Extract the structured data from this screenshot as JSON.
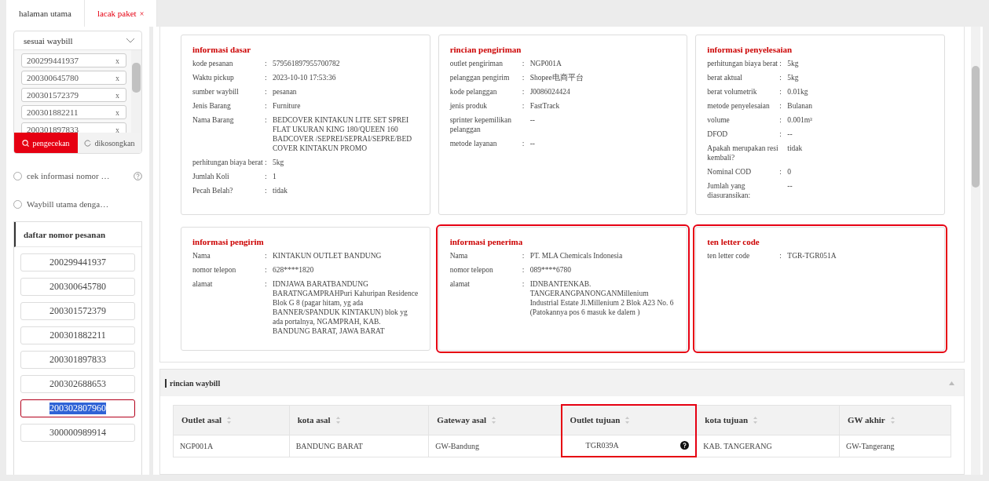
{
  "tabs": [
    {
      "label": "halaman utama",
      "selected": false
    },
    {
      "label": "lacak paket",
      "selected": true,
      "close": "×"
    }
  ],
  "search": {
    "mode": "sesuai waybill",
    "tags": [
      {
        "number": "200299441937",
        "remove": "x"
      },
      {
        "number": "200300645780",
        "remove": "x"
      },
      {
        "number": "200301572379",
        "remove": "x"
      },
      {
        "number": "200301882211",
        "remove": "x"
      },
      {
        "number": "200301897833",
        "remove": "x"
      }
    ],
    "buttons": [
      {
        "kind": "primary",
        "label": "pengecekan"
      },
      {
        "kind": "secondary",
        "label": "dikosongkan"
      }
    ],
    "options": [
      {
        "label": "cek informasi nomor …",
        "selected": false,
        "help": true
      },
      {
        "label": "Waybill utama denga…",
        "selected": false,
        "help": false
      }
    ]
  },
  "order_list": {
    "title": "daftar nomor pesanan",
    "items": [
      {
        "number": "200299441937",
        "selected": false
      },
      {
        "number": "200300645780",
        "selected": false
      },
      {
        "number": "200301572379",
        "selected": false
      },
      {
        "number": "200301882211",
        "selected": false
      },
      {
        "number": "200301897833",
        "selected": false
      },
      {
        "number": "200302688653",
        "selected": false
      },
      {
        "number": "200302807960",
        "selected": true
      },
      {
        "number": "300000989914",
        "selected": false
      }
    ]
  },
  "cards": [
    {
      "title": "informasi dasar",
      "highlighted": false,
      "fields": [
        {
          "label": "kode pesanan",
          "sep": ":",
          "value": "579561897955700782"
        },
        {
          "label": "Waktu pickup",
          "sep": ":",
          "value": "2023-10-10 17:53:36"
        },
        {
          "label": "sumber waybill",
          "sep": ":",
          "value": "pesanan"
        },
        {
          "label": "Jenis Barang",
          "sep": ":",
          "value": "Furniture"
        },
        {
          "label": "Nama Barang",
          "sep": ":",
          "value": "BEDCOVER KINTAKUN LITE SET SPREI FLAT UKURAN KING 180/QUEEN 160 BADCOVER /SEPREI/SEPRAI/SEPRE/BED COVER KINTAKUN PROMO"
        },
        {
          "label": "perhitungan biaya berat",
          "sep": ":",
          "value": "5kg"
        },
        {
          "label": "Jumlah Koli",
          "sep": ":",
          "value": "1"
        },
        {
          "label": "Pecah Belah?",
          "sep": ":",
          "value": "tidak"
        }
      ]
    },
    {
      "title": "rincian pengiriman",
      "highlighted": false,
      "fields": [
        {
          "label": "outlet pengiriman",
          "sep": ":",
          "value": "NGP001A"
        },
        {
          "label": "pelanggan pengirim",
          "sep": ":",
          "value": "Shopee电商平台"
        },
        {
          "label": "kode pelanggan",
          "sep": ":",
          "value": "J0086024424"
        },
        {
          "label": "jenis produk",
          "sep": ":",
          "value": "FastTrack"
        },
        {
          "label": "sprinter kepemilikan pelanggan",
          "value": "--"
        },
        {
          "label": "metode layanan",
          "sep": ":",
          "value": "--"
        }
      ]
    },
    {
      "title": "informasi penyelesaian",
      "highlighted": false,
      "fields": [
        {
          "label": "perhitungan biaya berat",
          "sep": ":",
          "value": "5kg"
        },
        {
          "label": "berat aktual",
          "sep": ":",
          "value": "5kg"
        },
        {
          "label": "berat volumetrik",
          "sep": ":",
          "value": "0.01kg"
        },
        {
          "label": "metode penyelesaian",
          "sep": ":",
          "value": "Bulanan"
        },
        {
          "label": "volume",
          "sep": ":",
          "value": "0.001m³"
        },
        {
          "label": "DFOD",
          "sep": ":",
          "value": "--"
        },
        {
          "label": "Apakah merupakan resi kembali?",
          "value": "tidak"
        },
        {
          "label": "Nominal COD",
          "sep": ":",
          "value": "0"
        },
        {
          "label": "Jumlah yang diasuransikan:",
          "value": "--"
        }
      ]
    },
    {
      "title": "informasi pengirim",
      "highlighted": false,
      "fields": [
        {
          "label": "Nama",
          "sep": ":",
          "value": "KINTAKUN OUTLET BANDUNG"
        },
        {
          "label": "nomor telepon",
          "sep": ":",
          "value": "628****1820"
        },
        {
          "label": "alamat",
          "sep": ":",
          "value": "IDNJAWA BARATBANDUNG BARATNGAMPRAHPuri Kahuripan Residence Blok G 8 (pagar hitam, yg ada BANNER/SPANDUK KINTAKUN) blok yg ada portalnya, NGAMPRAH, KAB. BANDUNG BARAT, JAWA BARAT"
        }
      ]
    },
    {
      "title": "informasi penerima",
      "highlighted": true,
      "fields": [
        {
          "label": "Nama",
          "sep": ":",
          "value": "PT. MLA Chemicals Indonesia"
        },
        {
          "label": "nomor telepon",
          "sep": ":",
          "value": "089****6780"
        },
        {
          "label": "alamat",
          "sep": ":",
          "value": "IDNBANTENKAB. TANGERANGPANONGANMillenium Industrial Estate Jl.Millenium 2 Blok A23 No. 6 (Patokannya pos 6 masuk ke dalem )"
        }
      ]
    },
    {
      "title": "ten letter code",
      "highlighted": true,
      "fields": [
        {
          "label": "ten letter code",
          "sep": ":",
          "value": "TGR-TGR051A"
        }
      ]
    }
  ],
  "waybill_section": {
    "title": "rincian waybill",
    "expanded": true,
    "columns": [
      {
        "label": "Outlet asal",
        "highlighted": false
      },
      {
        "label": "kota asal",
        "highlighted": false
      },
      {
        "label": "Gateway asal",
        "highlighted": false
      },
      {
        "label": "Outlet tujuan",
        "highlighted": true
      },
      {
        "label": "kota tujuan",
        "highlighted": false
      },
      {
        "label": "GW akhir",
        "highlighted": false
      }
    ],
    "rows": [
      {
        "cells": [
          {
            "text": "NGP001A",
            "help": false
          },
          {
            "text": "BANDUNG BARAT",
            "help": false
          },
          {
            "text": "GW-Bandung",
            "help": false
          },
          {
            "text": "TGR039A",
            "help": true
          },
          {
            "text": "KAB. TANGERANG",
            "help": false
          },
          {
            "text": "GW-Tangerang",
            "help": false
          }
        ]
      }
    ]
  }
}
